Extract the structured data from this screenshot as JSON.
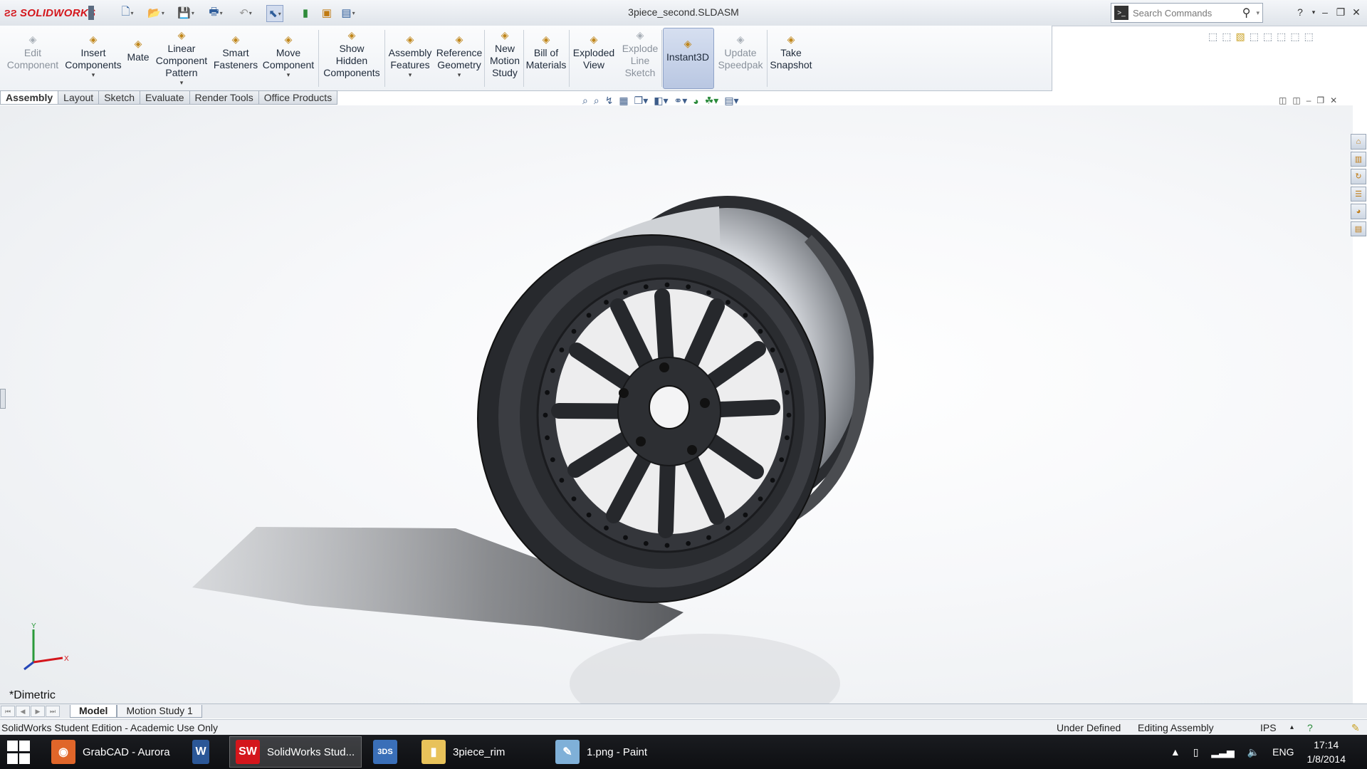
{
  "app": {
    "brand": "SOLIDWORKS",
    "document_title": "3piece_second.SLDASM",
    "search_placeholder": "Search Commands"
  },
  "commands": [
    {
      "key": "edit-component",
      "label": "Edit\nComponent",
      "disabled": true,
      "icon": "edit-component-icon"
    },
    {
      "key": "insert-components",
      "label": "Insert\nComponents",
      "dropdown": true,
      "icon": "insert-components-icon"
    },
    {
      "key": "mate",
      "label": "Mate",
      "icon": "mate-icon"
    },
    {
      "key": "linear-component-pattern",
      "label": "Linear\nComponent\nPattern",
      "dropdown": true,
      "icon": "linear-pattern-icon"
    },
    {
      "key": "smart-fasteners",
      "label": "Smart\nFasteners",
      "icon": "smart-fasteners-icon"
    },
    {
      "key": "move-component",
      "label": "Move\nComponent",
      "dropdown": true,
      "icon": "move-component-icon"
    },
    {
      "key": "show-hidden-components",
      "label": "Show\nHidden\nComponents",
      "icon": "show-hidden-icon"
    },
    {
      "key": "assembly-features",
      "label": "Assembly\nFeatures",
      "dropdown": true,
      "icon": "assembly-features-icon"
    },
    {
      "key": "reference-geometry",
      "label": "Reference\nGeometry",
      "dropdown": true,
      "icon": "reference-geometry-icon"
    },
    {
      "key": "new-motion-study",
      "label": "New\nMotion\nStudy",
      "icon": "motion-study-icon"
    },
    {
      "key": "bill-of-materials",
      "label": "Bill of\nMaterials",
      "icon": "bill-of-materials-icon"
    },
    {
      "key": "exploded-view",
      "label": "Exploded\nView",
      "icon": "exploded-view-icon"
    },
    {
      "key": "explode-line-sketch",
      "label": "Explode\nLine\nSketch",
      "disabled": true,
      "icon": "explode-line-icon"
    },
    {
      "key": "instant3d",
      "label": "Instant3D",
      "active": true,
      "icon": "instant3d-icon"
    },
    {
      "key": "update-speedpak",
      "label": "Update\nSpeedpak",
      "disabled": true,
      "icon": "speedpak-icon"
    },
    {
      "key": "take-snapshot",
      "label": "Take\nSnapshot",
      "icon": "snapshot-icon"
    }
  ],
  "tabs": [
    "Assembly",
    "Layout",
    "Sketch",
    "Evaluate",
    "Render Tools",
    "Office Products"
  ],
  "active_tab": "Assembly",
  "view_orientation": "*Dimetric",
  "triad": {
    "x": "X",
    "y": "Y"
  },
  "bottom_tabs": [
    "Model",
    "Motion Study 1"
  ],
  "status": {
    "left": "SolidWorks Student Edition - Academic Use Only",
    "state": "Under Defined",
    "mode": "Editing Assembly",
    "units": "IPS"
  },
  "taskbar": {
    "items": [
      {
        "label": "GrabCAD - Aurora",
        "icon": "firefox-icon"
      },
      {
        "label": "",
        "icon": "word-icon"
      },
      {
        "label": "SolidWorks Stud...",
        "icon": "solidworks-icon",
        "active": true
      },
      {
        "label": "",
        "icon": "3dexperience-icon"
      },
      {
        "label": "3piece_rim",
        "icon": "folder-icon"
      },
      {
        "label": "1.png - Paint",
        "icon": "paint-icon"
      }
    ],
    "language": "ENG",
    "time": "17:14",
    "date": "1/8/2014"
  },
  "colors": {
    "brand_red": "#d4161c",
    "rim_dark": "#2b2d31",
    "accent_blue": "#3d5d8a"
  }
}
